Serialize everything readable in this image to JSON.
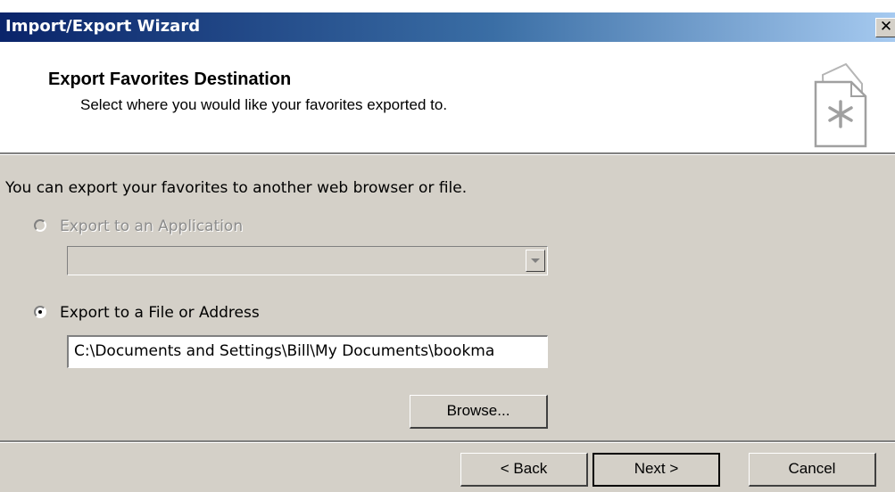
{
  "window": {
    "title": "Import/Export Wizard",
    "close_glyph": "✕"
  },
  "header": {
    "title": "Export Favorites Destination",
    "subtitle": "Select where you would like your favorites exported to.",
    "icon": "favorites-star-document-icon"
  },
  "body": {
    "intro": "You can export your favorites to another web browser or file.",
    "option_application": {
      "label": "Export to an Application",
      "selected": false,
      "enabled": false
    },
    "application_select": {
      "value": "",
      "enabled": false
    },
    "option_file": {
      "label": "Export to a File or Address",
      "selected": true,
      "enabled": true
    },
    "path_value": "C:\\Documents and Settings\\Bill\\My Documents\\bookma",
    "browse_label": "Browse..."
  },
  "footer": {
    "back_label": "< Back",
    "next_label": "Next >",
    "cancel_label": "Cancel"
  },
  "colors": {
    "titlebar_start": "#0a246a",
    "titlebar_end": "#a6caf0",
    "dialog_face": "#d4d0c8",
    "header_background": "#ffffff",
    "disabled_text": "#8c8c8c"
  }
}
